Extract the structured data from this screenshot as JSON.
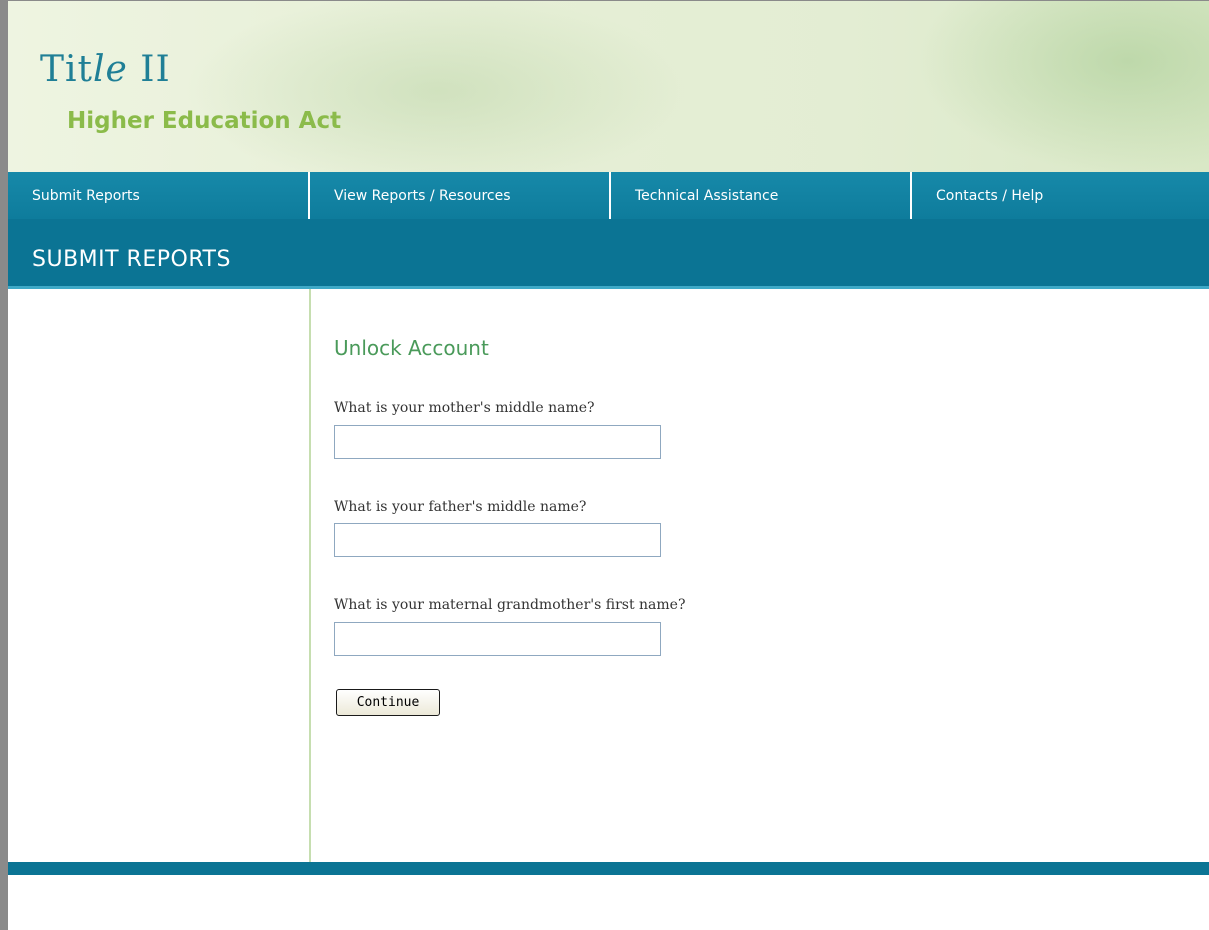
{
  "header": {
    "logo_title_roman": "Tit",
    "logo_title_italic": "le",
    "logo_title_suffix": " II",
    "logo_subtitle": "Higher Education Act"
  },
  "nav": {
    "items": [
      {
        "label": "Submit Reports"
      },
      {
        "label": "View Reports / Resources"
      },
      {
        "label": "Technical Assistance"
      },
      {
        "label": "Contacts / Help"
      }
    ]
  },
  "section": {
    "title": "SUBMIT REPORTS"
  },
  "main": {
    "heading": "Unlock Account",
    "questions": [
      {
        "label": "What is your mother's middle name?",
        "value": "",
        "placeholder": ""
      },
      {
        "label": "What is your father's middle name?",
        "value": "",
        "placeholder": ""
      },
      {
        "label": "What is your maternal grandmother's first name?",
        "value": "",
        "placeholder": ""
      }
    ],
    "continue_label": "Continue"
  },
  "colors": {
    "nav_bg": "#0e7c9c",
    "section_bg": "#0b7494",
    "heading_green": "#4a9a5a",
    "logo_blue": "#1f7f96",
    "logo_green": "#8bbb4a"
  }
}
